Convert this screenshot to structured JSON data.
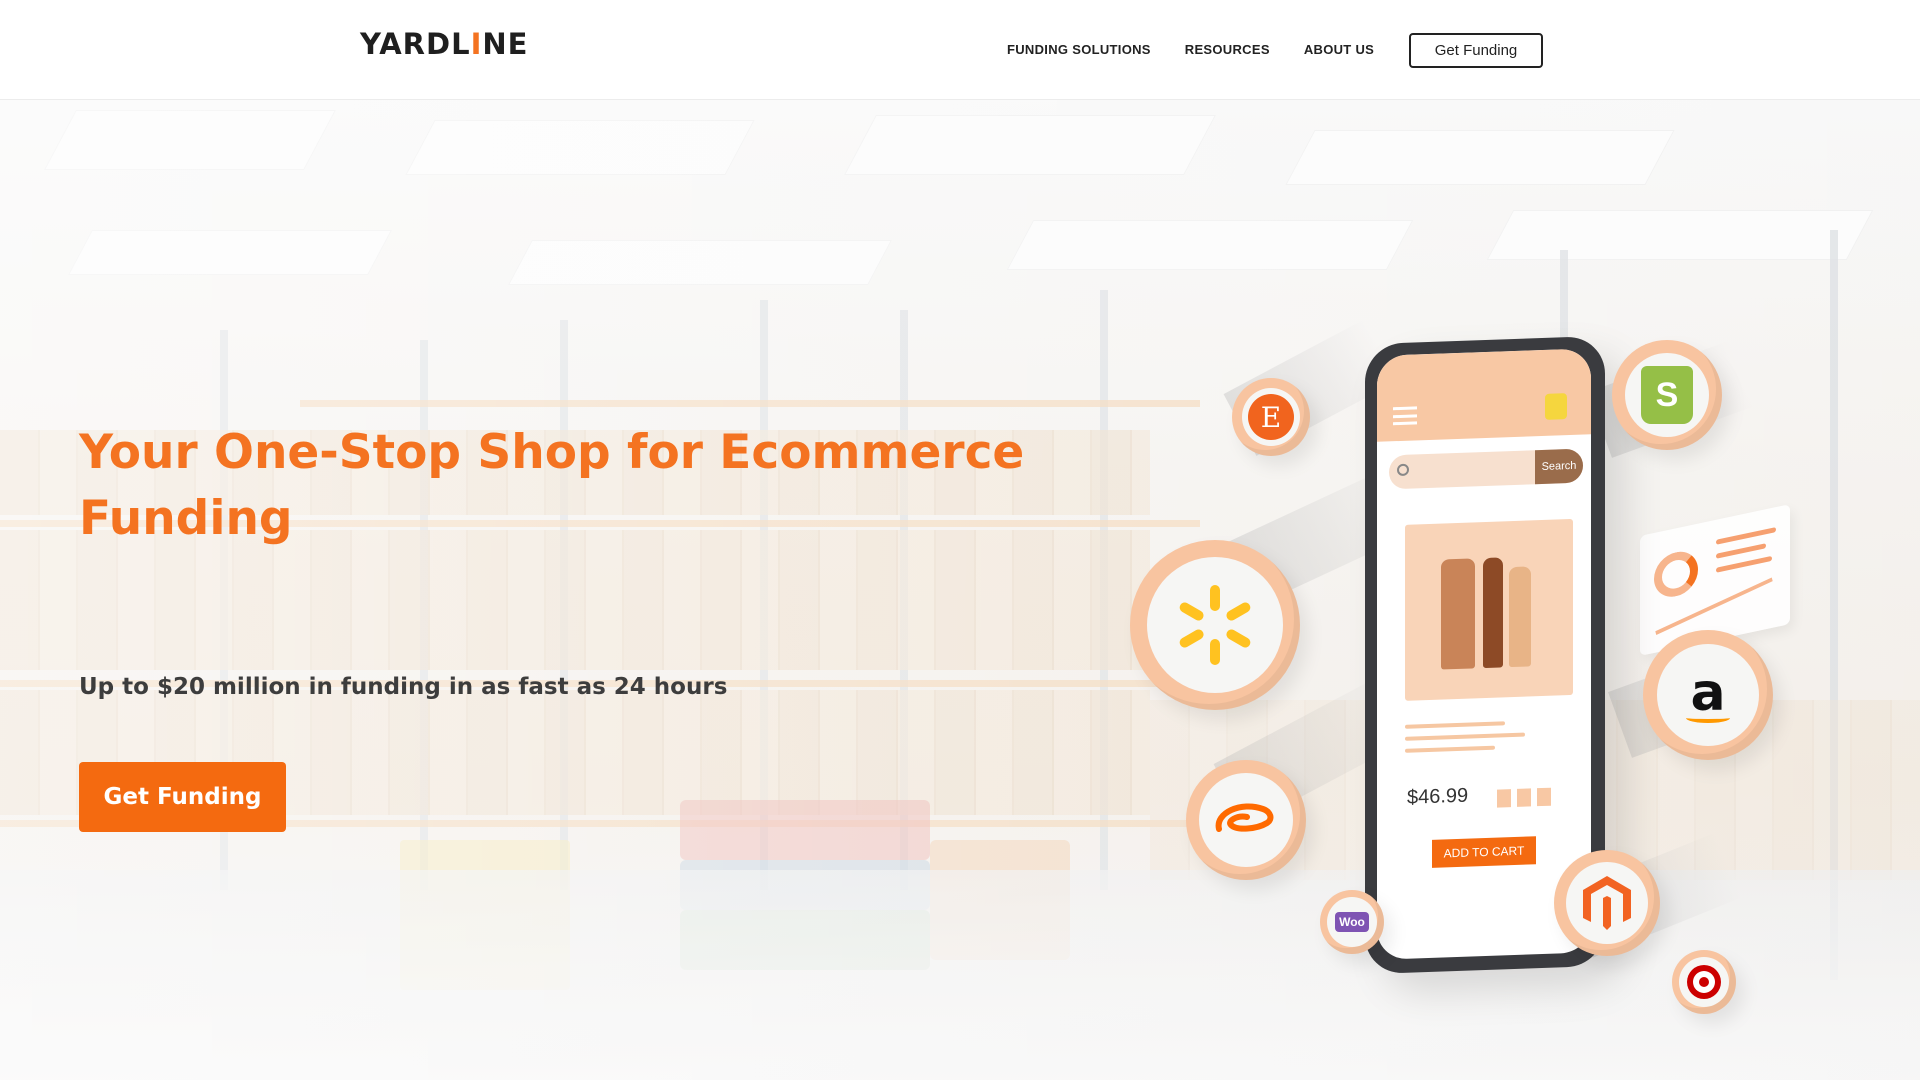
{
  "header": {
    "logo": {
      "part1": "YARDL",
      "accent": "I",
      "part2": "NE"
    },
    "nav": [
      {
        "label": "FUNDING SOLUTIONS"
      },
      {
        "label": "RESOURCES"
      },
      {
        "label": "ABOUT US"
      }
    ],
    "cta_label": "Get Funding"
  },
  "hero": {
    "title": "Your One-Stop Shop for Ecommerce Funding",
    "subtitle": "Up to $20 million in funding in as fast as 24 hours",
    "cta_label": "Get Funding"
  },
  "phone": {
    "search_button": "Search",
    "price": "$46.99",
    "add_to_cart": "ADD TO CART"
  },
  "badges": [
    {
      "icon": "etsy-icon",
      "glyph": "E"
    },
    {
      "icon": "shopify-icon",
      "glyph": "S"
    },
    {
      "icon": "walmart-icon",
      "glyph": ""
    },
    {
      "icon": "amazon-icon",
      "glyph": "a"
    },
    {
      "icon": "alibaba-icon",
      "glyph": ""
    },
    {
      "icon": "woocommerce-icon",
      "glyph": "Woo"
    },
    {
      "icon": "magento-icon",
      "glyph": ""
    },
    {
      "icon": "target-icon",
      "glyph": ""
    }
  ],
  "colors": {
    "brand_orange": "#f47321",
    "cta_orange": "#f46a10",
    "badge_ring": "#f8c4a0",
    "text_dark": "#3d3d3d"
  }
}
